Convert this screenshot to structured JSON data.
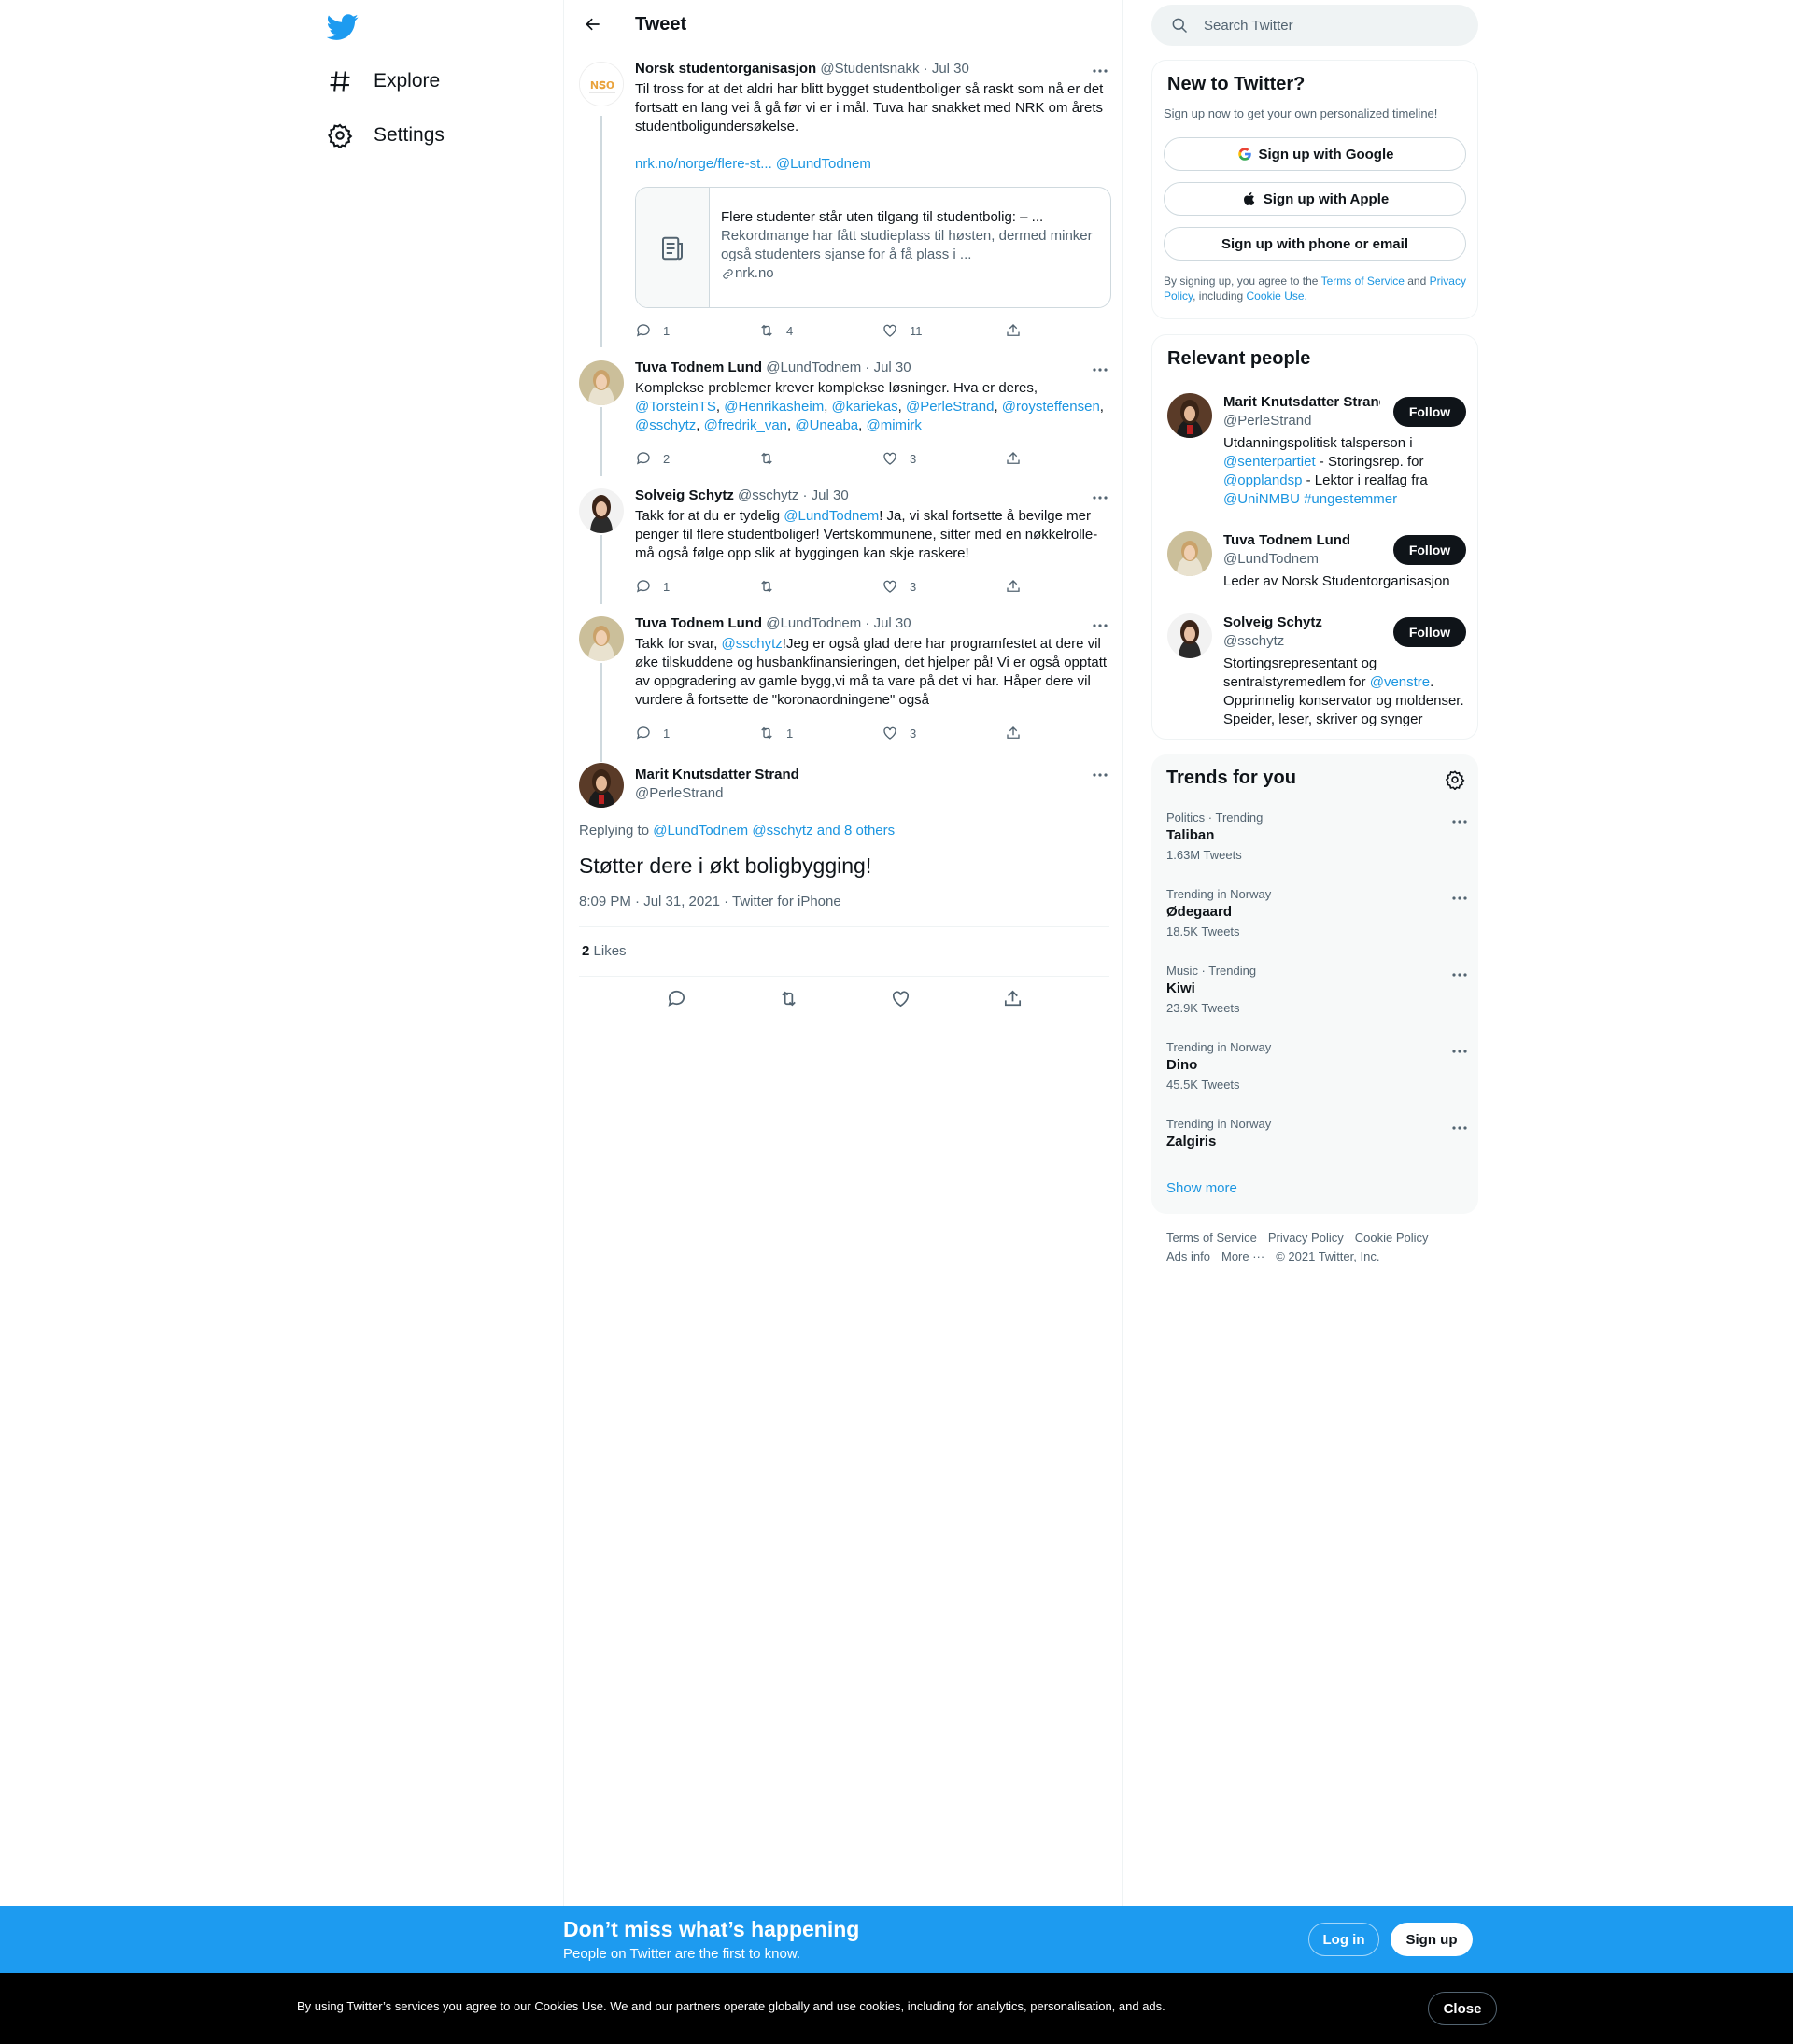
{
  "nav": {
    "explore_label": "Explore",
    "settings_label": "Settings"
  },
  "header": {
    "title": "Tweet"
  },
  "tweets": [
    {
      "name": "Norsk studentorganisasjon",
      "handle": "@Studentsnakk",
      "date": "Jul 30",
      "text": "Til tross for at det aldri har blitt bygget studentboliger så raskt som nå er det fortsatt en lang vei å gå før vi er i mål. Tuva har snakket med NRK om årets studentboligundersøkelse.",
      "link": "nrk.no/norge/flere-st...",
      "mention": "@LundTodnem",
      "card": {
        "title": "Flere studenter står uten tilgang til studentbolig: – ...",
        "desc": "Rekordmange har fått studieplass til høsten, dermed minker også studenters sjanse for å få plass i ...",
        "domain": "nrk.no"
      },
      "replies": "1",
      "retweets": "4",
      "likes": "11"
    },
    {
      "name": "Tuva Todnem Lund",
      "handle": "@LundTodnem",
      "date": "Jul 30",
      "text": "Komplekse problemer krever komplekse løsninger. Hva er deres,",
      "mentions": [
        "@TorsteinTS",
        "@Henrikasheim",
        "@kariekas",
        "@PerleStrand",
        "@roysteffensen",
        "@sschytz",
        "@fredrik_van",
        "@Uneaba",
        "@mimirk"
      ],
      "replies": "2",
      "retweets": "",
      "likes": "3"
    },
    {
      "name": "Solveig Schytz",
      "handle": "@sschytz",
      "date": "Jul 30",
      "text_a": "Takk for at du er tydelig ",
      "mention": "@LundTodnem",
      "text_b": "!  Ja, vi skal fortsette å bevilge mer penger til flere studentboliger! Vertskommunene, sitter med en nøkkelrolle-må også følge opp slik at byggingen kan skje raskere!",
      "replies": "1",
      "retweets": "",
      "likes": "3"
    },
    {
      "name": "Tuva Todnem Lund",
      "handle": "@LundTodnem",
      "date": "Jul 30",
      "text_a": "Takk for svar, ",
      "mention": "@sschytz",
      "text_b": "!Jeg er også glad dere har programfestet at dere vil øke tilskuddene og husbankfinansieringen, det hjelper på! Vi er også opptatt av oppgradering av gamle bygg,vi må ta vare på det vi har. Håper dere vil vurdere å fortsette de \"koronaordningene\" også",
      "replies": "1",
      "retweets": "1",
      "likes": "3"
    }
  ],
  "focus": {
    "name": "Marit Knutsdatter Strand",
    "handle": "@PerleStrand",
    "replying_prefix": "Replying to",
    "replying_to": "@LundTodnem @sschytz and 8 others",
    "text": "Støtter dere i økt boligbygging!",
    "timestamp": "8:09 PM · Jul 31, 2021 · Twitter for iPhone",
    "likes_count": "2",
    "likes_label": "Likes"
  },
  "search": {
    "placeholder": "Search Twitter"
  },
  "signup_panel": {
    "title": "New to Twitter?",
    "subtitle": "Sign up now to get your own personalized timeline!",
    "google": "Sign up with Google",
    "apple": "Sign up with Apple",
    "phone": "Sign up with phone or email",
    "legal_a": "By signing up, you agree to the ",
    "tos": "Terms of Service",
    "legal_b": " and ",
    "privacy": "Privacy Policy",
    "legal_c": ", including ",
    "cookie": "Cookie Use."
  },
  "relevant_people": {
    "title": "Relevant people",
    "follow_label": "Follow",
    "people": [
      {
        "name": "Marit Knutsdatter Strand",
        "handle": "@PerleStrand",
        "bio_a": "Utdanningspolitisk talsperson i ",
        "bio_m1": "@senterpartiet",
        "bio_b": " - Storingsrep. for ",
        "bio_m2": "@opplandsp",
        "bio_c": " - Lektor i realfag fra ",
        "bio_m3": "@UniNMBU",
        "bio_m4": "#ungestemmer"
      },
      {
        "name": "Tuva Todnem Lund",
        "handle": "@LundTodnem",
        "bio": "Leder av Norsk Studentorganisasjon"
      },
      {
        "name": "Solveig Schytz",
        "handle": "@sschytz",
        "bio_a": "Stortingsrepresentant og sentralstyremedlem for ",
        "bio_m1": "@venstre",
        "bio_b": ". Opprinnelig konservator og moldenser. Speider, leser, skriver og synger"
      }
    ]
  },
  "trends": {
    "title": "Trends for you",
    "items": [
      {
        "meta": "Politics · Trending",
        "name": "Taliban",
        "count": "1.63M Tweets"
      },
      {
        "meta": "Trending in Norway",
        "name": "Ødegaard",
        "count": "18.5K Tweets"
      },
      {
        "meta": "Music · Trending",
        "name": "Kiwi",
        "count": "23.9K Tweets"
      },
      {
        "meta": "Trending in Norway",
        "name": "Dino",
        "count": "45.5K Tweets"
      },
      {
        "meta": "Trending in Norway",
        "name": "Zalgiris",
        "count": ""
      }
    ],
    "show_more": "Show more"
  },
  "footer": {
    "tos": "Terms of Service",
    "privacy": "Privacy Policy",
    "cookie": "Cookie Policy",
    "ads": "Ads info",
    "more": "More ···",
    "copyright": "© 2021 Twitter, Inc."
  },
  "banner": {
    "title": "Don’t miss what’s happening",
    "subtitle": "People on Twitter are the first to know.",
    "login": "Log in",
    "signup": "Sign up"
  },
  "cookie_bar": {
    "text": "By using Twitter’s services you agree to our Cookies Use. We and our partners operate globally and use cookies, including for analytics, personalisation, and ads.",
    "close": "Close"
  },
  "colors": {
    "brand": "#1d9bf0",
    "link": "#1b95e0",
    "text": "#0f1419",
    "muted": "#536471"
  }
}
